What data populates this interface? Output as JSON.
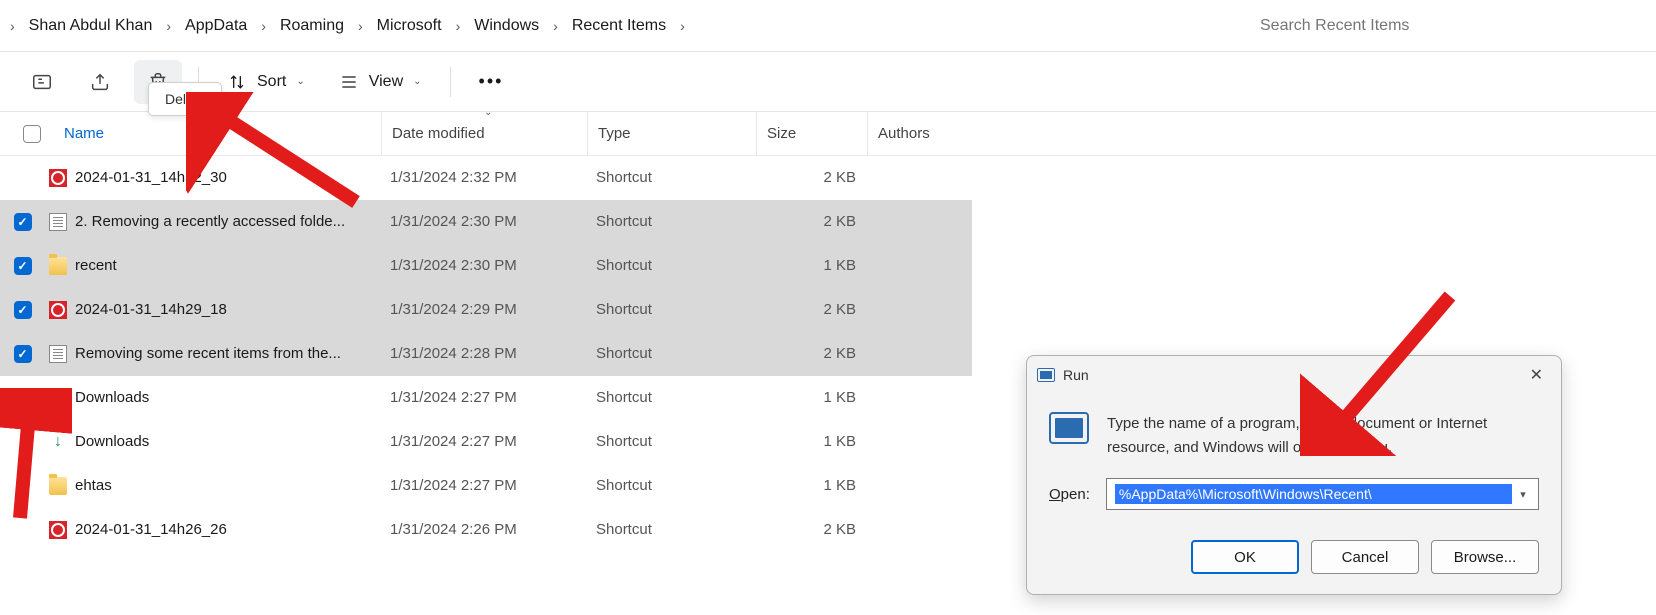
{
  "breadcrumb": [
    "Shan Abdul Khan",
    "AppData",
    "Roaming",
    "Microsoft",
    "Windows",
    "Recent Items"
  ],
  "search_placeholder": "Search Recent Items",
  "toolbar": {
    "sort_label": "Sort",
    "view_label": "View",
    "delete_tooltip": "Delete"
  },
  "columns": {
    "name": "Name",
    "date": "Date modified",
    "type": "Type",
    "size": "Size",
    "authors": "Authors"
  },
  "rows": [
    {
      "checked": false,
      "icon": "red",
      "name": "2024-01-31_14h32_30",
      "date": "1/31/2024 2:32 PM",
      "type": "Shortcut",
      "size": "2 KB"
    },
    {
      "checked": true,
      "icon": "doc",
      "name": "2. Removing a recently accessed folde...",
      "date": "1/31/2024 2:30 PM",
      "type": "Shortcut",
      "size": "2 KB"
    },
    {
      "checked": true,
      "icon": "folder",
      "name": "recent",
      "date": "1/31/2024 2:30 PM",
      "type": "Shortcut",
      "size": "1 KB"
    },
    {
      "checked": true,
      "icon": "red",
      "name": "2024-01-31_14h29_18",
      "date": "1/31/2024 2:29 PM",
      "type": "Shortcut",
      "size": "2 KB"
    },
    {
      "checked": true,
      "icon": "doc",
      "name": "Removing some recent items from the...",
      "date": "1/31/2024 2:28 PM",
      "type": "Shortcut",
      "size": "2 KB"
    },
    {
      "checked": false,
      "icon": "download",
      "name": "Downloads",
      "date": "1/31/2024 2:27 PM",
      "type": "Shortcut",
      "size": "1 KB"
    },
    {
      "checked": false,
      "icon": "download",
      "name": "Downloads",
      "date": "1/31/2024 2:27 PM",
      "type": "Shortcut",
      "size": "1 KB"
    },
    {
      "checked": false,
      "icon": "folder",
      "name": "ehtas",
      "date": "1/31/2024 2:27 PM",
      "type": "Shortcut",
      "size": "1 KB"
    },
    {
      "checked": false,
      "icon": "red",
      "name": "2024-01-31_14h26_26",
      "date": "1/31/2024 2:26 PM",
      "type": "Shortcut",
      "size": "2 KB"
    }
  ],
  "run": {
    "title": "Run",
    "description": "Type the name of a program, folder, document or Internet resource, and Windows will open it for you.",
    "open_label": "Open:",
    "value": "%AppData%\\Microsoft\\Windows\\Recent\\",
    "ok": "OK",
    "cancel": "Cancel",
    "browse": "Browse..."
  }
}
